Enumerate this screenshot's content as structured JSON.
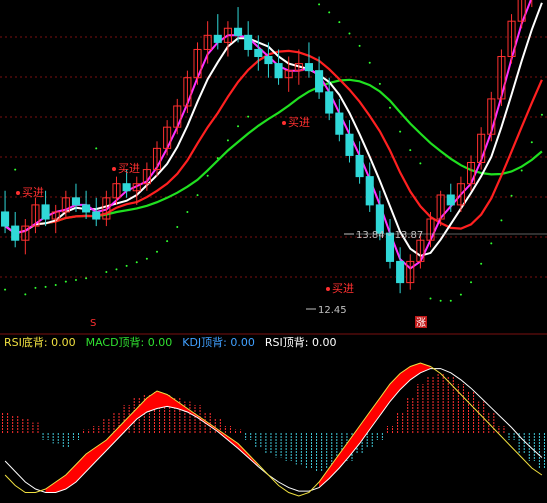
{
  "colors": {
    "background": "#000000",
    "grid": "#7a1010",
    "up": "#ff3030",
    "down": "#30d8d8",
    "hollow_up": "#ff4040",
    "green_bar": "#30e030",
    "ma_white": "#ffffff",
    "ma_magenta": "#ff30ff",
    "ma_red": "#ff2020",
    "ma_green": "#20e020",
    "dots": "#30ff30",
    "hist_pos": "#ff3030",
    "hist_neg": "#40c8d8",
    "osc_line": "#f0e040",
    "osc_line2": "#ffffff",
    "fill": "#ff0000"
  },
  "main_panel": {
    "annotations": [
      {
        "text": "买进",
        "kind": "buy",
        "x": 22,
        "y": 196
      },
      {
        "text": "买进",
        "kind": "buy",
        "x": 118,
        "y": 172
      },
      {
        "text": "买进",
        "kind": "buy",
        "x": 288,
        "y": 126
      },
      {
        "text": "买进",
        "kind": "buy",
        "x": 332,
        "y": 292
      }
    ],
    "price_labels": [
      {
        "text": "13.84 - 13.87",
        "x": 356,
        "y": 238
      },
      {
        "text": "12.45",
        "x": 318,
        "y": 313
      }
    ],
    "markers": [
      {
        "text": "S",
        "x": 93,
        "y": 325,
        "color": "#ff3030"
      },
      {
        "text": "涨",
        "x": 421,
        "y": 325,
        "color": "#ff3030"
      }
    ]
  },
  "indicator_bar": {
    "items": [
      {
        "label": "RSI底背:",
        "value": "0.00",
        "color": "#f0e040"
      },
      {
        "label": "MACD顶背:",
        "value": "0.00",
        "color": "#30e030"
      },
      {
        "label": "KDJ顶背:",
        "value": "0.00",
        "color": "#40a0ff"
      },
      {
        "label": "RSI顶背:",
        "value": "0.00",
        "color": "#ffffff"
      }
    ]
  },
  "chart_data": {
    "type": "line",
    "title": "",
    "xlabel": "",
    "ylabel": "",
    "grid": true,
    "candles": [
      [
        13.6,
        13.9,
        13.3,
        13.4
      ],
      [
        13.4,
        13.6,
        13.1,
        13.2
      ],
      [
        13.2,
        13.5,
        13.0,
        13.4
      ],
      [
        13.4,
        13.8,
        13.3,
        13.7
      ],
      [
        13.7,
        13.9,
        13.4,
        13.5
      ],
      [
        13.5,
        13.7,
        13.3,
        13.6
      ],
      [
        13.6,
        13.9,
        13.5,
        13.8
      ],
      [
        13.8,
        14.0,
        13.6,
        13.7
      ],
      [
        13.7,
        13.9,
        13.5,
        13.6
      ],
      [
        13.6,
        13.8,
        13.4,
        13.5
      ],
      [
        13.5,
        13.9,
        13.4,
        13.8
      ],
      [
        13.8,
        14.1,
        13.7,
        14.0
      ],
      [
        14.0,
        14.2,
        13.8,
        13.9
      ],
      [
        13.9,
        14.1,
        13.7,
        14.0
      ],
      [
        14.0,
        14.3,
        13.9,
        14.2
      ],
      [
        14.2,
        14.6,
        14.1,
        14.5
      ],
      [
        14.5,
        14.9,
        14.4,
        14.8
      ],
      [
        14.8,
        15.2,
        14.7,
        15.1
      ],
      [
        15.1,
        15.6,
        15.0,
        15.5
      ],
      [
        15.5,
        16.0,
        15.4,
        15.9
      ],
      [
        15.9,
        16.3,
        15.7,
        16.1
      ],
      [
        16.1,
        16.4,
        15.9,
        16.0
      ],
      [
        16.0,
        16.3,
        15.8,
        16.2
      ],
      [
        16.2,
        16.5,
        16.0,
        16.1
      ],
      [
        16.1,
        16.3,
        15.8,
        15.9
      ],
      [
        15.9,
        16.1,
        15.6,
        15.8
      ],
      [
        15.8,
        16.0,
        15.5,
        15.7
      ],
      [
        15.7,
        15.9,
        15.4,
        15.5
      ],
      [
        15.5,
        15.8,
        15.3,
        15.6
      ],
      [
        15.6,
        15.9,
        15.4,
        15.7
      ],
      [
        15.7,
        16.0,
        15.5,
        15.6
      ],
      [
        15.6,
        15.8,
        15.2,
        15.3
      ],
      [
        15.3,
        15.5,
        14.9,
        15.0
      ],
      [
        15.0,
        15.2,
        14.6,
        14.7
      ],
      [
        14.7,
        14.9,
        14.3,
        14.4
      ],
      [
        14.4,
        14.6,
        14.0,
        14.1
      ],
      [
        14.1,
        14.3,
        13.6,
        13.7
      ],
      [
        13.7,
        13.9,
        13.2,
        13.3
      ],
      [
        13.3,
        13.5,
        12.8,
        12.9
      ],
      [
        12.9,
        13.1,
        12.45,
        12.6
      ],
      [
        12.6,
        13.0,
        12.5,
        12.9
      ],
      [
        12.9,
        13.3,
        12.8,
        13.2
      ],
      [
        13.2,
        13.6,
        13.1,
        13.5
      ],
      [
        13.5,
        13.9,
        13.4,
        13.84
      ],
      [
        13.84,
        14.0,
        13.6,
        13.7
      ],
      [
        13.7,
        14.1,
        13.6,
        14.0
      ],
      [
        14.0,
        14.4,
        13.9,
        14.3
      ],
      [
        14.3,
        14.8,
        14.2,
        14.7
      ],
      [
        14.7,
        15.3,
        14.6,
        15.2
      ],
      [
        15.2,
        15.9,
        15.1,
        15.8
      ],
      [
        15.8,
        16.4,
        15.7,
        16.3
      ],
      [
        16.3,
        16.8,
        16.2,
        16.7
      ],
      [
        16.7,
        17.0,
        16.5,
        16.9
      ],
      [
        16.9,
        17.2,
        16.7,
        17.1
      ]
    ],
    "ylim": [
      12.0,
      16.6
    ],
    "oscillator": {
      "histogram": [
        0.3,
        0.25,
        0.2,
        0.15,
        -0.1,
        -0.15,
        -0.2,
        -0.1,
        0.05,
        0.1,
        0.2,
        0.3,
        0.4,
        0.5,
        0.55,
        0.6,
        0.55,
        0.5,
        0.45,
        0.4,
        0.3,
        0.2,
        0.1,
        0.05,
        -0.1,
        -0.2,
        -0.3,
        -0.35,
        -0.4,
        -0.45,
        -0.5,
        -0.55,
        -0.5,
        -0.45,
        -0.4,
        -0.3,
        -0.2,
        -0.1,
        0.1,
        0.3,
        0.5,
        0.7,
        0.8,
        0.85,
        0.8,
        0.7,
        0.6,
        0.45,
        0.3,
        0.1,
        -0.1,
        -0.3,
        -0.4,
        -0.5
      ],
      "fast": [
        -0.6,
        -0.75,
        -0.85,
        -0.85,
        -0.8,
        -0.7,
        -0.6,
        -0.45,
        -0.3,
        -0.2,
        -0.1,
        0.05,
        0.2,
        0.35,
        0.5,
        0.6,
        0.55,
        0.45,
        0.35,
        0.25,
        0.15,
        0.05,
        -0.05,
        -0.15,
        -0.3,
        -0.45,
        -0.6,
        -0.75,
        -0.85,
        -0.9,
        -0.85,
        -0.7,
        -0.5,
        -0.3,
        -0.1,
        0.1,
        0.3,
        0.5,
        0.7,
        0.85,
        0.95,
        1.0,
        0.95,
        0.85,
        0.7,
        0.55,
        0.4,
        0.25,
        0.1,
        -0.05,
        -0.2,
        -0.35,
        -0.5,
        -0.6
      ],
      "slow": [
        -0.4,
        -0.55,
        -0.7,
        -0.8,
        -0.85,
        -0.85,
        -0.8,
        -0.7,
        -0.55,
        -0.4,
        -0.25,
        -0.1,
        0.05,
        0.2,
        0.3,
        0.35,
        0.38,
        0.35,
        0.3,
        0.22,
        0.12,
        0.02,
        -0.1,
        -0.22,
        -0.35,
        -0.48,
        -0.6,
        -0.7,
        -0.78,
        -0.83,
        -0.83,
        -0.78,
        -0.65,
        -0.5,
        -0.33,
        -0.15,
        0.05,
        0.25,
        0.45,
        0.62,
        0.76,
        0.86,
        0.92,
        0.92,
        0.86,
        0.76,
        0.64,
        0.5,
        0.36,
        0.22,
        0.08,
        -0.08,
        -0.22,
        -0.35
      ]
    }
  }
}
